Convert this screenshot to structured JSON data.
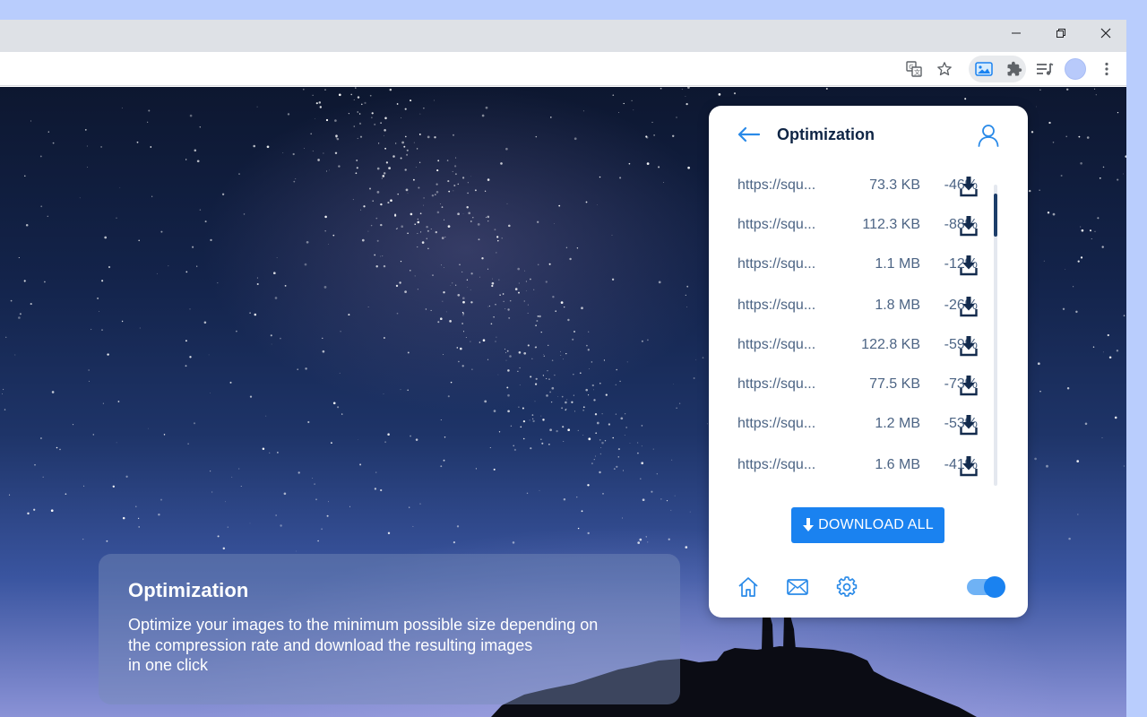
{
  "browser": {
    "window_controls": [
      "minimize",
      "restore",
      "close"
    ],
    "toolbar_icons": [
      "translate-icon",
      "star-icon",
      "extension-image-icon",
      "puzzle-icon",
      "reading-list-icon",
      "profile-avatar",
      "more-icon"
    ]
  },
  "caption": {
    "title": "Optimization",
    "description_line1": "Optimize your images to the minimum possible size depending on",
    "description_line2": "the compression rate and download the resulting images",
    "description_line3": "in one click"
  },
  "popup": {
    "title": "Optimization",
    "rows": [
      {
        "url": "https://squ...",
        "size": "73.3 KB",
        "reduction": "-46%"
      },
      {
        "url": "https://squ...",
        "size": "112.3 KB",
        "reduction": "-88%"
      },
      {
        "url": "https://squ...",
        "size": "1.1 MB",
        "reduction": "-12%"
      },
      {
        "url": "https://squ...",
        "size": "1.8 MB",
        "reduction": "-26%"
      },
      {
        "url": "https://squ...",
        "size": "122.8 KB",
        "reduction": "-59%"
      },
      {
        "url": "https://squ...",
        "size": "77.5 KB",
        "reduction": "-73%"
      },
      {
        "url": "https://squ...",
        "size": "1.2 MB",
        "reduction": "-53%"
      },
      {
        "url": "https://squ...",
        "size": "1.6 MB",
        "reduction": "-41%"
      }
    ],
    "download_all_label": "DOWNLOAD ALL",
    "footer_icons": [
      "home-icon",
      "mail-icon",
      "settings-icon"
    ],
    "toggle_on": true,
    "accent_color": "#1a82f0"
  }
}
